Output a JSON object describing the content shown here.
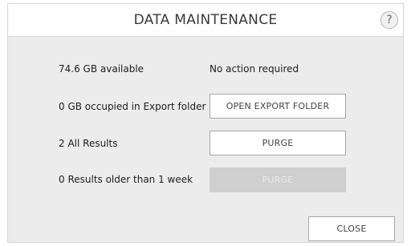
{
  "dialog": {
    "title": "DATA MAINTENANCE",
    "help_label": "?"
  },
  "rows": [
    {
      "label": "74.6 GB available",
      "status": "No action required"
    },
    {
      "label": "0 GB occupied in Export folder",
      "button": "OPEN EXPORT FOLDER"
    },
    {
      "label": "2 All Results",
      "button": "PURGE"
    },
    {
      "label": "0 Results older than 1 week",
      "button": "PURGE",
      "button_enabled": false
    }
  ],
  "footer": {
    "close_label": "CLOSE"
  }
}
